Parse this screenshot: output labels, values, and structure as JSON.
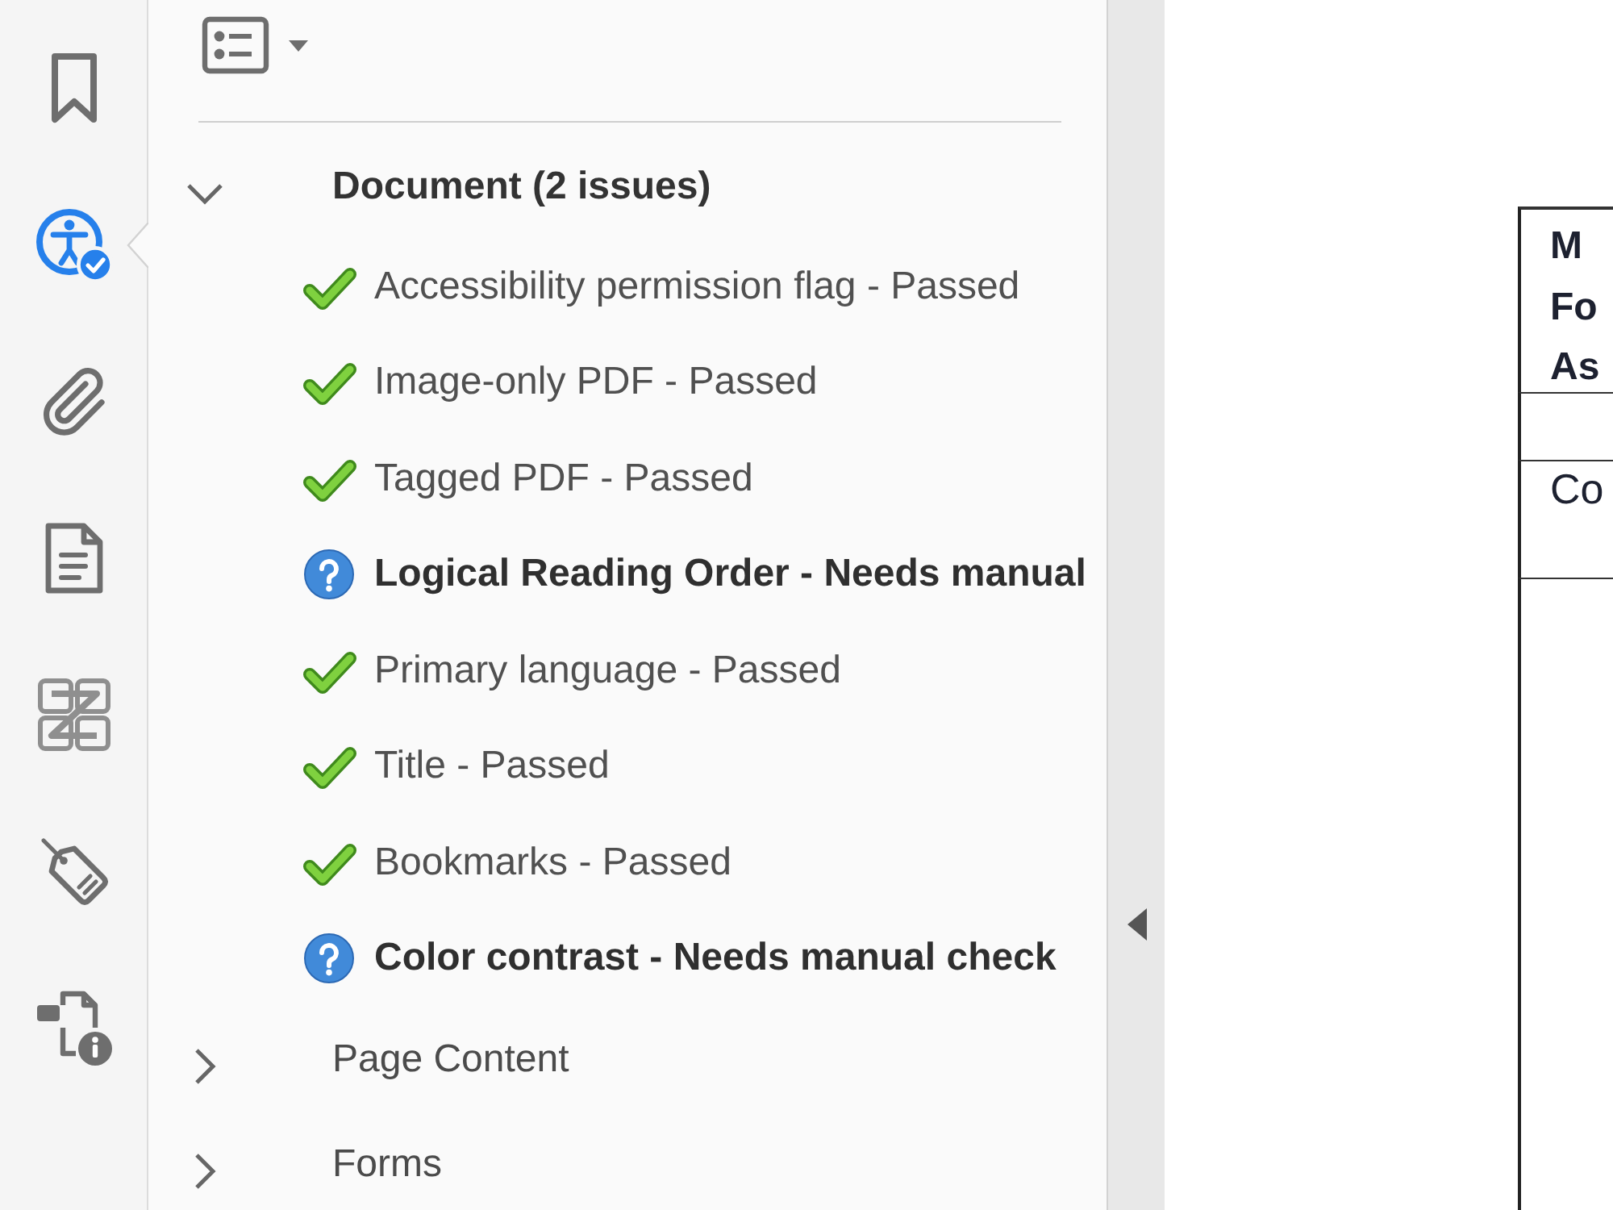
{
  "tool_rail": {
    "tools": [
      {
        "kind": "bookmark",
        "selected": false
      },
      {
        "kind": "accessibility",
        "selected": true
      },
      {
        "kind": "attachment",
        "selected": false
      },
      {
        "kind": "page",
        "selected": false
      },
      {
        "kind": "order",
        "selected": false
      },
      {
        "kind": "tag",
        "selected": false
      },
      {
        "kind": "info",
        "selected": false
      }
    ]
  },
  "checker_panel": {
    "tree": [
      {
        "label": "Document (2 issues)",
        "expanded": true,
        "children": [
          {
            "kind": "passed",
            "label": "Accessibility permission flag - Passed"
          },
          {
            "kind": "passed",
            "label": "Image-only PDF - Passed"
          },
          {
            "kind": "passed",
            "label": "Tagged PDF - Passed"
          },
          {
            "kind": "manual",
            "label": "Logical Reading Order - Needs manual"
          },
          {
            "kind": "passed",
            "label": "Primary language - Passed"
          },
          {
            "kind": "passed",
            "label": "Title - Passed"
          },
          {
            "kind": "passed",
            "label": "Bookmarks - Passed"
          },
          {
            "kind": "manual",
            "label": "Color contrast - Needs manual check"
          }
        ]
      },
      {
        "label": "Page Content",
        "expanded": false
      },
      {
        "label": "Forms",
        "expanded": false
      }
    ]
  },
  "document_view": {
    "table_rows": [
      {
        "kind": "heading",
        "lines": [
          "M",
          "Fo",
          "As"
        ]
      },
      {
        "kind": "blank"
      },
      {
        "kind": "text",
        "lines": [
          "Co"
        ]
      },
      {
        "kind": "blank"
      }
    ]
  }
}
